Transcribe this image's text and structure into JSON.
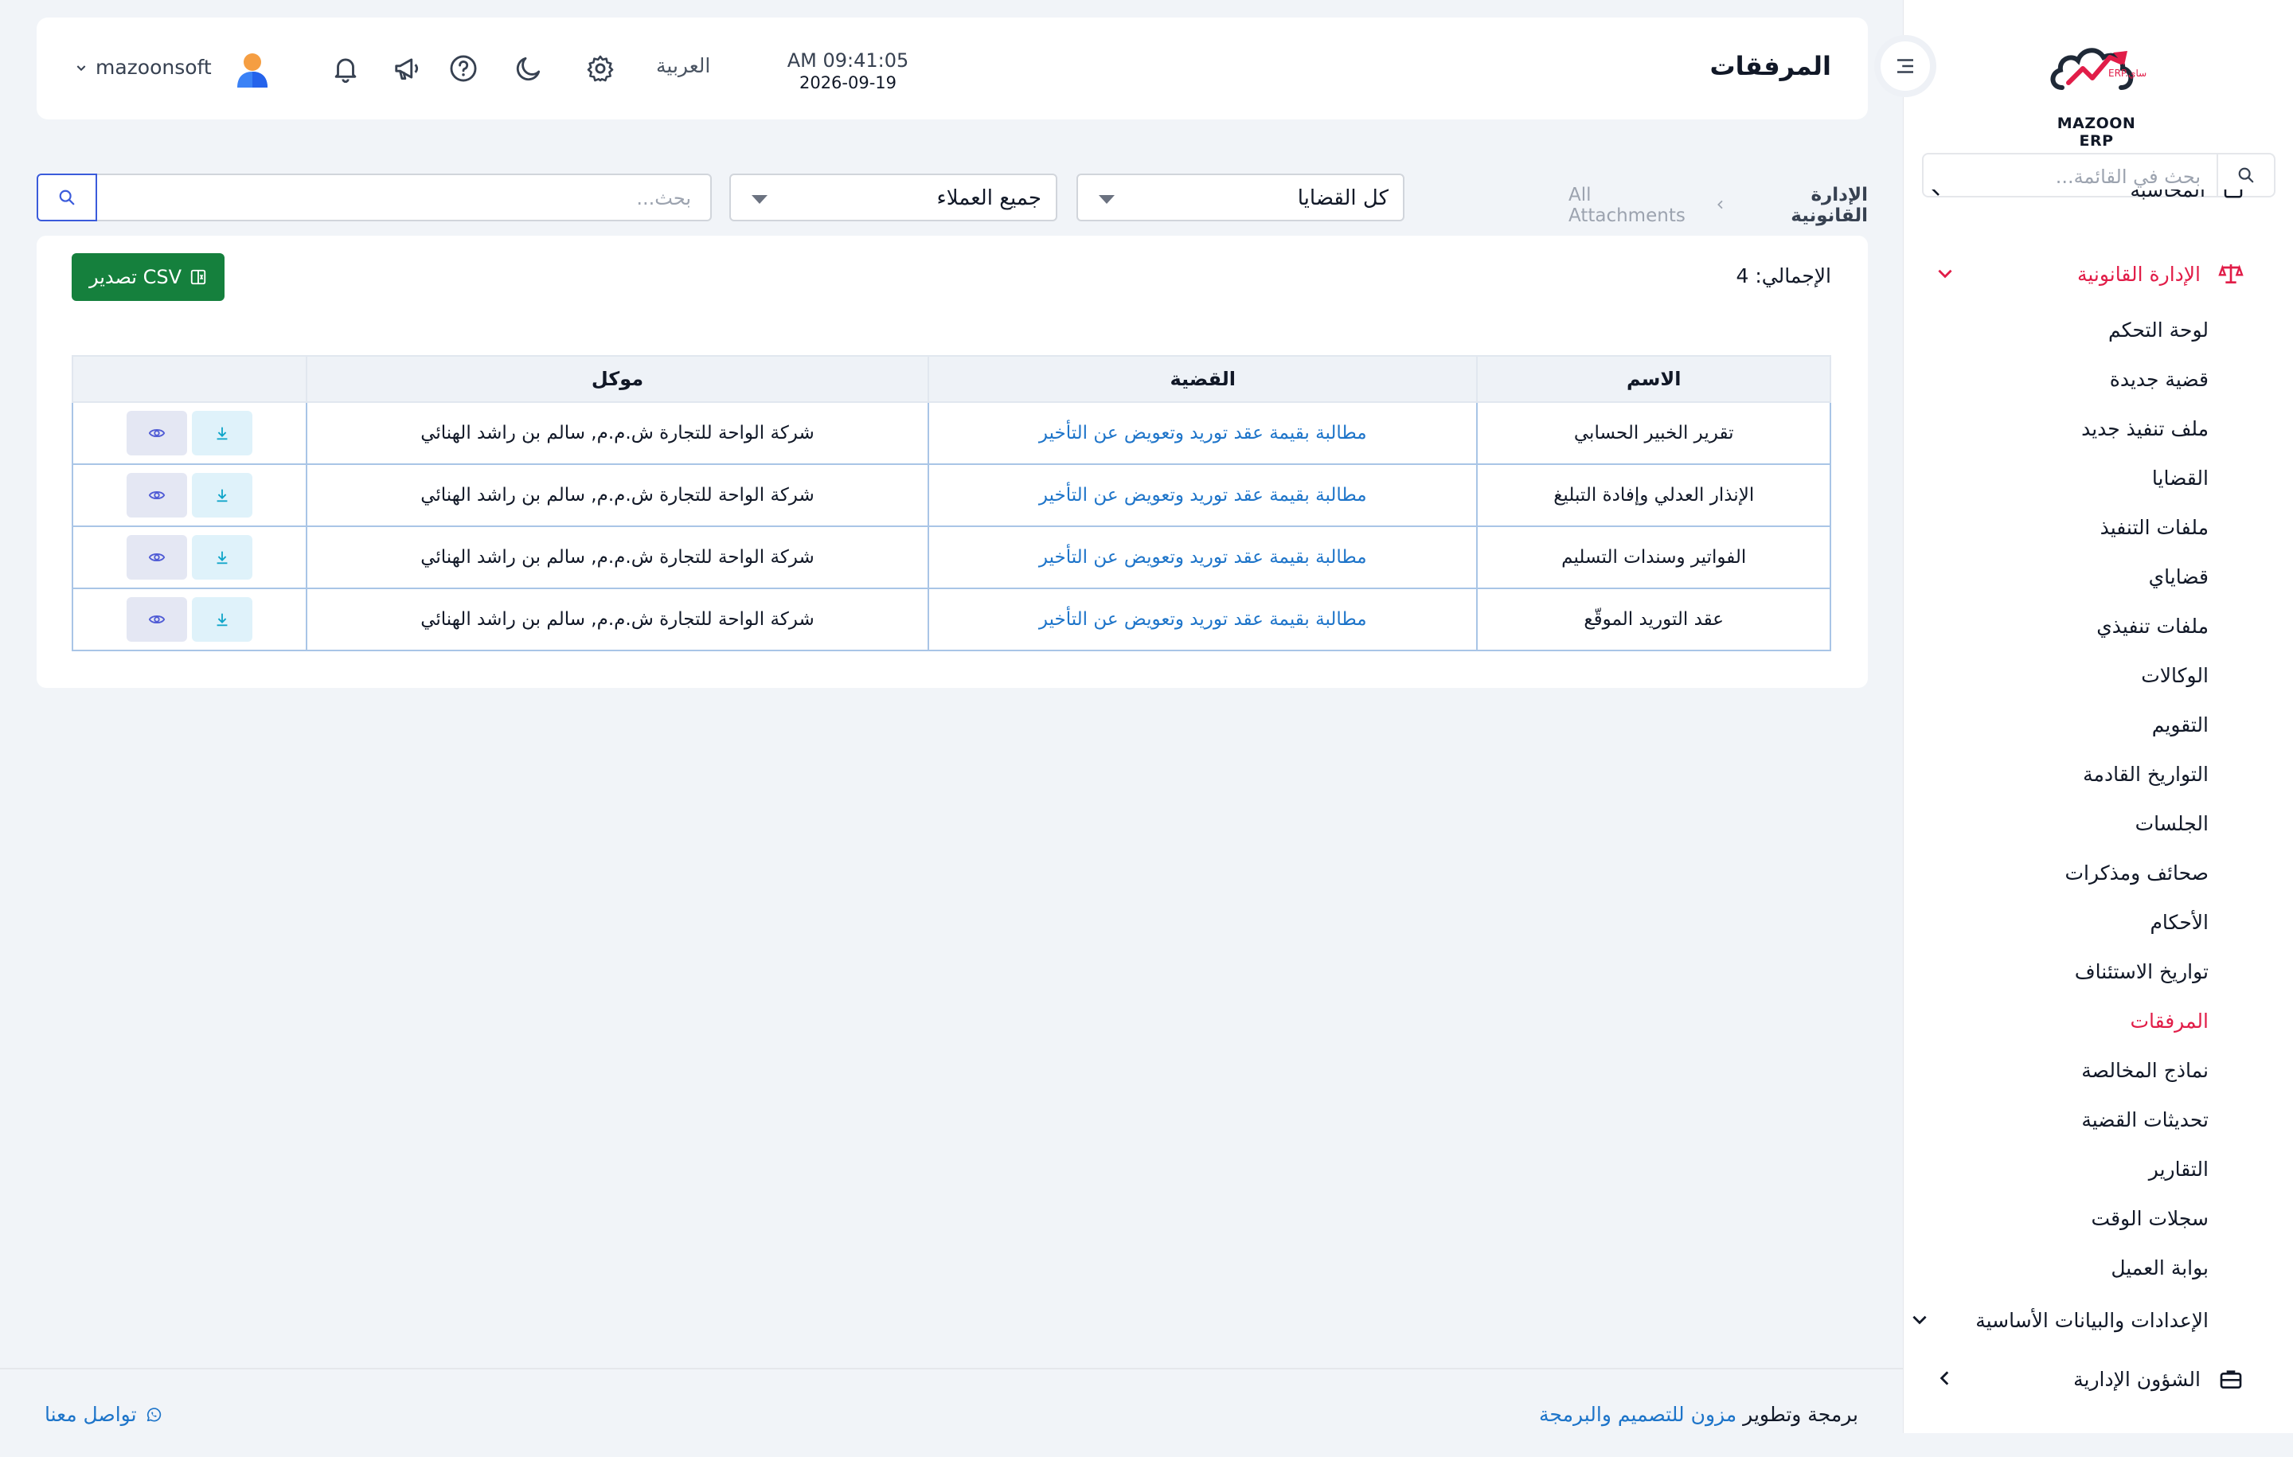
{
  "app": {
    "logo_text": "MAZOON ERP",
    "logo_sub": "ERP.ساي"
  },
  "sidebar": {
    "search_placeholder": "بحث في القائمة...",
    "clipped_item": "المحاسبة",
    "active_group": "الإدارة القانونية",
    "items": [
      {
        "label": "لوحة التحكم",
        "active": false
      },
      {
        "label": "قضية جديدة",
        "active": false
      },
      {
        "label": "ملف تنفيذ جديد",
        "active": false
      },
      {
        "label": "القضايا",
        "active": false
      },
      {
        "label": "ملفات التنفيذ",
        "active": false
      },
      {
        "label": "قضاياي",
        "active": false
      },
      {
        "label": "ملفات تنفيذي",
        "active": false
      },
      {
        "label": "الوكالات",
        "active": false
      },
      {
        "label": "التقويم",
        "active": false
      },
      {
        "label": "التواريخ القادمة",
        "active": false
      },
      {
        "label": "الجلسات",
        "active": false
      },
      {
        "label": "صحائف ومذكرات",
        "active": false
      },
      {
        "label": "الأحكام",
        "active": false
      },
      {
        "label": "تواريخ الاستئناف",
        "active": false
      },
      {
        "label": "المرفقات",
        "active": true
      },
      {
        "label": "نماذج المخالصة",
        "active": false
      },
      {
        "label": "تحديثات القضية",
        "active": false
      },
      {
        "label": "التقارير",
        "active": false
      },
      {
        "label": "سجلات الوقت",
        "active": false
      },
      {
        "label": "بوابة العميل",
        "active": false
      }
    ],
    "settings_group": "الإعدادات والبيانات الأساسية",
    "admin_group": "الشؤون الإدارية"
  },
  "header": {
    "title": "المرفقات",
    "time": "AM 09:41:05",
    "date": "2026-09-19",
    "language": "العربية",
    "username": "mazoonsoft"
  },
  "toolbar": {
    "breadcrumb_home": "الإدارة القانونية",
    "breadcrumb_current": "All Attachments",
    "case_filter": "كل القضايا",
    "client_filter": "جميع العملاء",
    "search_placeholder": "بحث..."
  },
  "card": {
    "total_label": "الإجمالي: 4",
    "csv_label": "تصدير CSV"
  },
  "table": {
    "headers": {
      "name": "الاسم",
      "case": "القضية",
      "client": "موكل"
    },
    "rows": [
      {
        "name": "تقرير الخبير الحسابي",
        "case": "مطالبة بقيمة عقد توريد وتعويض عن التأخير",
        "client": "شركة الواحة للتجارة ش.م.م, سالم بن راشد الهنائي"
      },
      {
        "name": "الإنذار العدلي وإفادة التبليغ",
        "case": "مطالبة بقيمة عقد توريد وتعويض عن التأخير",
        "client": "شركة الواحة للتجارة ش.م.م, سالم بن راشد الهنائي"
      },
      {
        "name": "الفواتير وسندات التسليم",
        "case": "مطالبة بقيمة عقد توريد وتعويض عن التأخير",
        "client": "شركة الواحة للتجارة ش.م.م, سالم بن راشد الهنائي"
      },
      {
        "name": "عقد التوريد الموقّع",
        "case": "مطالبة بقيمة عقد توريد وتعويض عن التأخير",
        "client": "شركة الواحة للتجارة ش.م.م, سالم بن راشد الهنائي"
      }
    ]
  },
  "footer": {
    "credit_prefix": "برمجة وتطوير",
    "credit_link": "مزون للتصميم والبرمجة",
    "contact": "تواصل معنا"
  },
  "colors": {
    "accent_red": "#e11d48",
    "link_blue": "#1d74c9",
    "csv_green": "#15803d"
  }
}
